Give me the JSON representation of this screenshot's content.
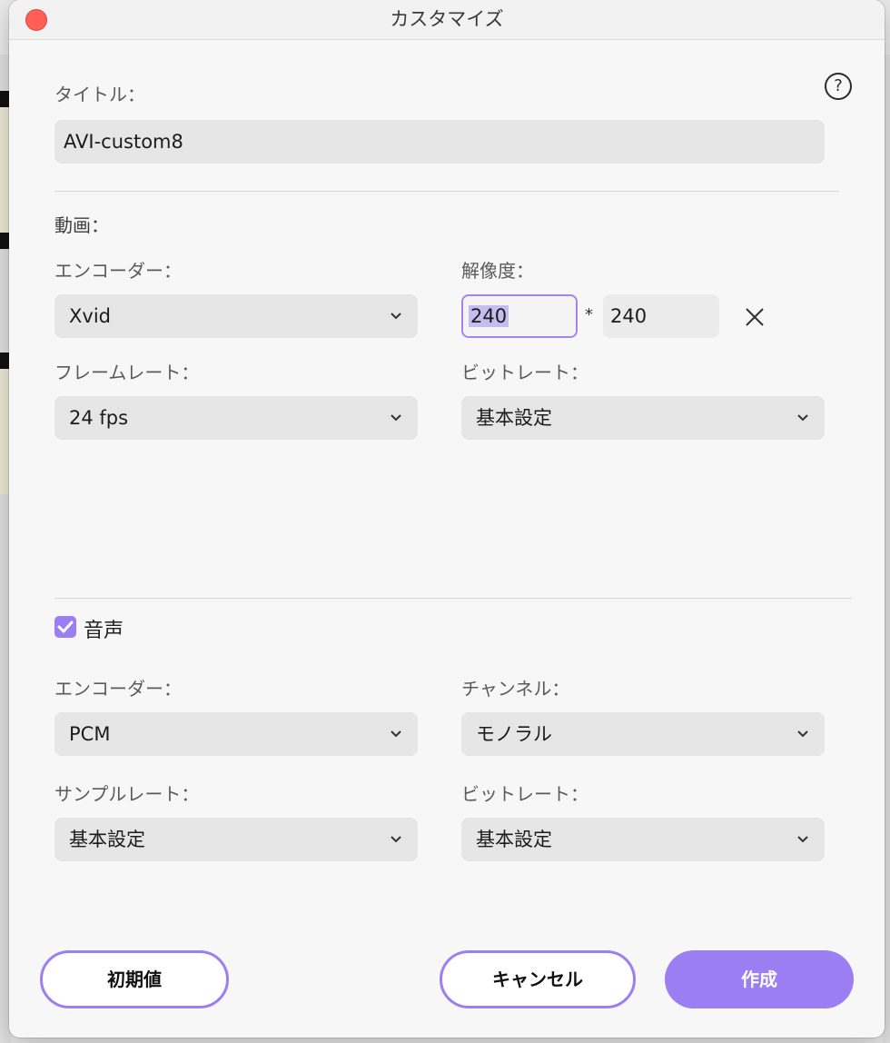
{
  "window": {
    "title": "カスタマイズ"
  },
  "help": {
    "icon": "help-circle-icon",
    "glyph": "?"
  },
  "title_section": {
    "label": "タイトル：",
    "value": "AVI-custom8"
  },
  "video": {
    "section_label": "動画：",
    "encoder": {
      "label": "エンコーダー：",
      "value": "Xvid"
    },
    "resolution": {
      "label": "解像度：",
      "width": "240",
      "separator": "*",
      "height": "240"
    },
    "framerate": {
      "label": "フレームレート：",
      "value": "24 fps"
    },
    "bitrate": {
      "label": "ビットレート：",
      "value": "基本設定"
    }
  },
  "audio": {
    "enabled": true,
    "section_label": "音声",
    "encoder": {
      "label": "エンコーダー：",
      "value": "PCM"
    },
    "channel": {
      "label": "チャンネル：",
      "value": "モノラル"
    },
    "samplerate": {
      "label": "サンプルレート：",
      "value": "基本設定"
    },
    "bitrate": {
      "label": "ビットレート：",
      "value": "基本設定"
    }
  },
  "buttons": {
    "reset": "初期値",
    "cancel": "キャンセル",
    "create": "作成"
  },
  "colors": {
    "accent": "#9b7ef1",
    "close": "#fe5f57",
    "field_bg": "#e6e6e6"
  }
}
